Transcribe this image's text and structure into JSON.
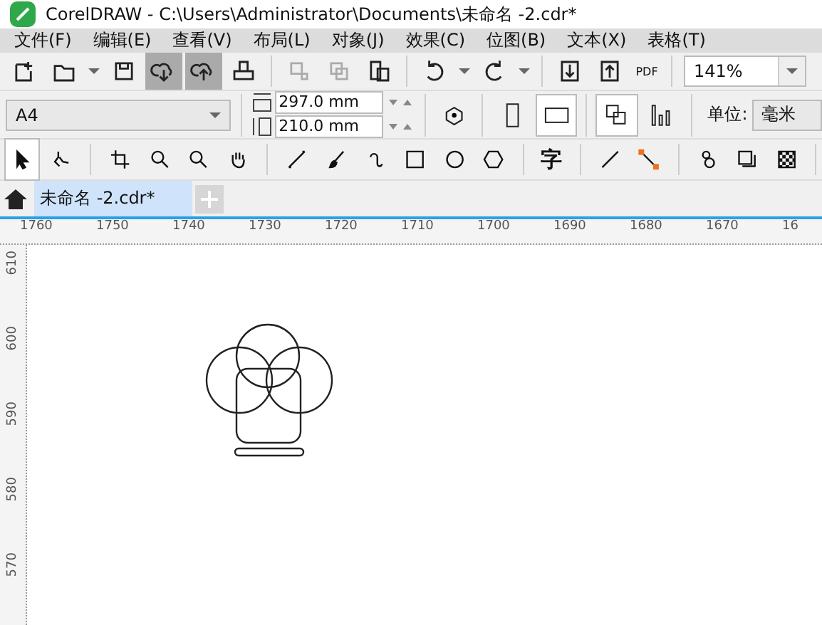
{
  "window": {
    "title": "CorelDRAW - C:\\Users\\Administrator\\Documents\\未命名 -2.cdr*"
  },
  "menu": [
    "文件(F)",
    "编辑(E)",
    "查看(V)",
    "布局(L)",
    "对象(J)",
    "效果(C)",
    "位图(B)",
    "文本(X)",
    "表格(T)"
  ],
  "toolbar": {
    "buttons": [
      {
        "kind": "new",
        "selected": false
      },
      {
        "kind": "open",
        "selected": false
      },
      {
        "kind": "save",
        "selected": false
      },
      {
        "kind": "download",
        "selected": true
      },
      {
        "kind": "upload",
        "selected": true
      },
      {
        "kind": "print",
        "selected": false
      },
      {
        "kind": "cut",
        "selected": false
      },
      {
        "kind": "copy",
        "selected": false
      },
      {
        "kind": "paste",
        "selected": false
      },
      {
        "kind": "undo",
        "selected": false
      },
      {
        "kind": "redo",
        "selected": false
      },
      {
        "kind": "import",
        "selected": false
      },
      {
        "kind": "export",
        "selected": false
      }
    ],
    "pdf_label": "PDF",
    "zoom": "141%"
  },
  "property_bar": {
    "page_size": "A4",
    "width": "297.0 mm",
    "height": "210.0 mm",
    "portrait_selected": false,
    "landscape_selected": true,
    "units_label": "单位:",
    "units": "毫米"
  },
  "toolbox": [
    {
      "kind": "pick",
      "selected": true
    },
    {
      "kind": "shape",
      "selected": false
    },
    {
      "kind": "crop",
      "selected": false
    },
    {
      "kind": "zoom",
      "selected": false
    },
    {
      "kind": "zoom",
      "selected": false
    },
    {
      "kind": "pan",
      "selected": false
    },
    {
      "kind": "curve",
      "selected": false
    },
    {
      "kind": "brush",
      "selected": false
    },
    {
      "kind": "spiral",
      "selected": false
    },
    {
      "kind": "rect",
      "selected": false
    },
    {
      "kind": "ellipse",
      "selected": false
    },
    {
      "kind": "polygon",
      "selected": false
    },
    {
      "kind": "text",
      "selected": false,
      "label": "字"
    },
    {
      "kind": "line",
      "selected": false
    },
    {
      "kind": "connector",
      "selected": false
    },
    {
      "kind": "blend",
      "selected": false
    },
    {
      "kind": "shadow",
      "selected": false
    },
    {
      "kind": "transparency",
      "selected": false
    }
  ],
  "tabs": [
    {
      "label": "未命名 -2.cdr*",
      "selected": true
    }
  ],
  "ruler": {
    "horizontal": [
      "1760",
      "1750",
      "1740",
      "1730",
      "1720",
      "1710",
      "1700",
      "1690",
      "1680",
      "1670",
      "16"
    ],
    "vertical": [
      "610",
      "600",
      "590",
      "580",
      "570"
    ]
  }
}
